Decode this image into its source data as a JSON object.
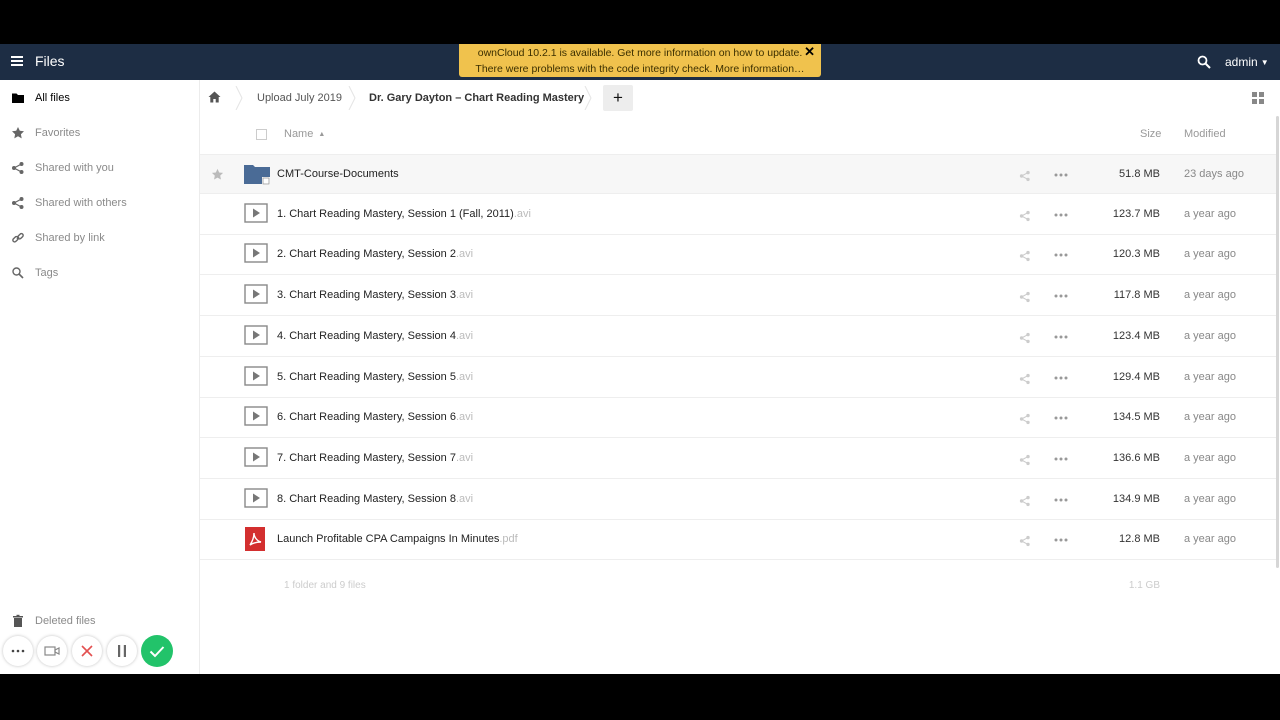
{
  "header": {
    "app_title": "Files",
    "user": "admin",
    "notification": {
      "line1": "ownCloud 10.2.1 is available. Get more information on how to update.",
      "line2": "There were problems with the code integrity check. More information…"
    }
  },
  "sidebar": {
    "items": [
      {
        "label": "All files",
        "icon": "folder-icon",
        "active": true
      },
      {
        "label": "Favorites",
        "icon": "star-icon"
      },
      {
        "label": "Shared with you",
        "icon": "share-icon"
      },
      {
        "label": "Shared with others",
        "icon": "share-icon"
      },
      {
        "label": "Shared by link",
        "icon": "link-icon"
      },
      {
        "label": "Tags",
        "icon": "tag-icon"
      }
    ],
    "deleted_files": "Deleted files"
  },
  "breadcrumb": {
    "items": [
      "Upload July 2019",
      "Dr. Gary Dayton – Chart Reading Mastery"
    ]
  },
  "table": {
    "headers": {
      "name": "Name",
      "size": "Size",
      "modified": "Modified"
    },
    "files": [
      {
        "name": "CMT-Course-Documents",
        "ext": "",
        "type": "folder",
        "size": "51.8 MB",
        "modified": "23 days ago"
      },
      {
        "name": "1. Chart Reading Mastery, Session 1 (Fall, 2011)",
        "ext": ".avi",
        "type": "video",
        "size": "123.7 MB",
        "modified": "a year ago"
      },
      {
        "name": "2. Chart Reading Mastery, Session 2",
        "ext": ".avi",
        "type": "video",
        "size": "120.3 MB",
        "modified": "a year ago"
      },
      {
        "name": "3. Chart Reading Mastery, Session 3",
        "ext": ".avi",
        "type": "video",
        "size": "117.8 MB",
        "modified": "a year ago"
      },
      {
        "name": "4. Chart Reading Mastery, Session 4",
        "ext": ".avi",
        "type": "video",
        "size": "123.4 MB",
        "modified": "a year ago"
      },
      {
        "name": "5. Chart Reading Mastery, Session 5",
        "ext": ".avi",
        "type": "video",
        "size": "129.4 MB",
        "modified": "a year ago"
      },
      {
        "name": "6. Chart Reading Mastery, Session 6",
        "ext": ".avi",
        "type": "video",
        "size": "134.5 MB",
        "modified": "a year ago"
      },
      {
        "name": "7. Chart Reading Mastery, Session 7",
        "ext": ".avi",
        "type": "video",
        "size": "136.6 MB",
        "modified": "a year ago"
      },
      {
        "name": "8. Chart Reading Mastery, Session 8",
        "ext": ".avi",
        "type": "video",
        "size": "134.9 MB",
        "modified": "a year ago"
      },
      {
        "name": "Launch Profitable CPA Campaigns In Minutes",
        "ext": ".pdf",
        "type": "pdf",
        "size": "12.8 MB",
        "modified": "a year ago"
      }
    ],
    "summary": "1 folder and 9 files",
    "total_size": "1.1 GB"
  },
  "colors": {
    "header_bg": "#1d2d44",
    "notification_bg": "#f0c24d",
    "folder": "#4a6b96",
    "pdf": "#d32f2f",
    "confirm": "#22c36a"
  }
}
